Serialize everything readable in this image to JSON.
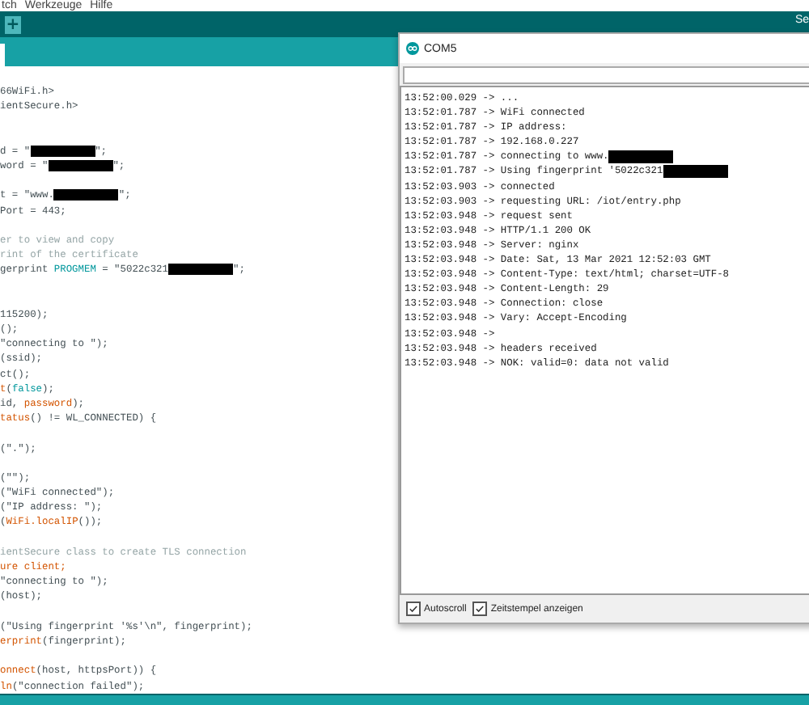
{
  "menu_bar": {
    "items": [
      "tch",
      "Werkzeuge",
      "Hilfe"
    ]
  },
  "toolbar": {
    "add_button": "+",
    "right_label": "Se"
  },
  "editor": {
    "lines": [
      [
        {
          "kind": "code",
          "text": "66WiFi.h>"
        }
      ],
      [
        {
          "kind": "code",
          "text": "ientSecure.h>"
        }
      ],
      [
        {
          "kind": "blank"
        }
      ],
      [
        {
          "kind": "blank"
        }
      ],
      [
        {
          "kind": "code",
          "text": "d = \""
        },
        {
          "kind": "redaction"
        },
        {
          "kind": "code",
          "text": "\";"
        }
      ],
      [
        {
          "kind": "code",
          "text": "word = \""
        },
        {
          "kind": "redaction"
        },
        {
          "kind": "code",
          "text": "\";"
        }
      ],
      [
        {
          "kind": "blank"
        }
      ],
      [
        {
          "kind": "code",
          "text": "t = \"www."
        },
        {
          "kind": "redaction"
        },
        {
          "kind": "code",
          "text": "\";"
        }
      ],
      [
        {
          "kind": "code",
          "text": "Port = 443;"
        }
      ],
      [
        {
          "kind": "blank"
        }
      ],
      [
        {
          "kind": "comment",
          "text": "er to view and copy"
        }
      ],
      [
        {
          "kind": "comment",
          "text": "rint of the certificate"
        }
      ],
      [
        {
          "kind": "code",
          "text": "gerprint "
        },
        {
          "kind": "keyword",
          "text": "PROGMEM"
        },
        {
          "kind": "code",
          "text": " = \"5022c321"
        },
        {
          "kind": "redaction"
        },
        {
          "kind": "code",
          "text": "\";"
        }
      ],
      [
        {
          "kind": "blank"
        }
      ],
      [
        {
          "kind": "blank"
        }
      ],
      [
        {
          "kind": "code",
          "text": "115200);"
        }
      ],
      [
        {
          "kind": "code",
          "text": "();"
        }
      ],
      [
        {
          "kind": "code",
          "text": "\"connecting to \");"
        }
      ],
      [
        {
          "kind": "code",
          "text": "(ssid);"
        }
      ],
      [
        {
          "kind": "code",
          "text": "ct();"
        }
      ],
      [
        {
          "kind": "function",
          "text": "t"
        },
        {
          "kind": "code",
          "text": "("
        },
        {
          "kind": "keyword",
          "text": "false"
        },
        {
          "kind": "code",
          "text": ");"
        }
      ],
      [
        {
          "kind": "code",
          "text": "id, "
        },
        {
          "kind": "function",
          "text": "password"
        },
        {
          "kind": "code",
          "text": ");"
        }
      ],
      [
        {
          "kind": "function",
          "text": "tatus"
        },
        {
          "kind": "code",
          "text": "() != WL_CONNECTED) {"
        }
      ],
      [
        {
          "kind": "blank"
        }
      ],
      [
        {
          "kind": "code",
          "text": "(\".\");"
        }
      ],
      [
        {
          "kind": "blank"
        }
      ],
      [
        {
          "kind": "code",
          "text": "(\"\");"
        }
      ],
      [
        {
          "kind": "code",
          "text": "(\"WiFi connected\");"
        }
      ],
      [
        {
          "kind": "code",
          "text": "(\"IP address: \");"
        }
      ],
      [
        {
          "kind": "code",
          "text": "("
        },
        {
          "kind": "function",
          "text": "WiFi.localIP"
        },
        {
          "kind": "code",
          "text": "());"
        }
      ],
      [
        {
          "kind": "blank"
        }
      ],
      [
        {
          "kind": "comment",
          "text": "ientSecure class to create TLS connection"
        }
      ],
      [
        {
          "kind": "function",
          "text": "ure client;"
        }
      ],
      [
        {
          "kind": "code",
          "text": "\"connecting to \");"
        }
      ],
      [
        {
          "kind": "code",
          "text": "(host);"
        }
      ],
      [
        {
          "kind": "blank"
        }
      ],
      [
        {
          "kind": "code",
          "text": "(\"Using fingerprint '%s'\\n\", fingerprint);"
        }
      ],
      [
        {
          "kind": "function",
          "text": "erprint"
        },
        {
          "kind": "code",
          "text": "(fingerprint);"
        }
      ],
      [
        {
          "kind": "blank"
        }
      ],
      [
        {
          "kind": "function",
          "text": "onnect"
        },
        {
          "kind": "code",
          "text": "(host, httpsPort)) {"
        }
      ],
      [
        {
          "kind": "function",
          "text": "ln"
        },
        {
          "kind": "code",
          "text": "(\"connection failed\");"
        }
      ]
    ]
  },
  "serial_monitor": {
    "title": "COM5",
    "lines": [
      [
        {
          "kind": "text",
          "text": "13:52:00.029 -> ..."
        }
      ],
      [
        {
          "kind": "text",
          "text": "13:52:01.787 -> WiFi connected"
        }
      ],
      [
        {
          "kind": "text",
          "text": "13:52:01.787 -> IP address:"
        }
      ],
      [
        {
          "kind": "text",
          "text": "13:52:01.787 -> 192.168.0.227"
        }
      ],
      [
        {
          "kind": "text",
          "text": "13:52:01.787 -> connecting to www."
        },
        {
          "kind": "redaction"
        }
      ],
      [
        {
          "kind": "text",
          "text": "13:52:01.787 -> Using fingerprint '5022c321"
        },
        {
          "kind": "redaction"
        }
      ],
      [
        {
          "kind": "text",
          "text": "13:52:03.903 -> connected"
        }
      ],
      [
        {
          "kind": "text",
          "text": "13:52:03.903 -> requesting URL: /iot/entry.php"
        }
      ],
      [
        {
          "kind": "text",
          "text": "13:52:03.948 -> request sent"
        }
      ],
      [
        {
          "kind": "text",
          "text": "13:52:03.948 -> HTTP/1.1 200 OK"
        }
      ],
      [
        {
          "kind": "text",
          "text": "13:52:03.948 -> Server: nginx"
        }
      ],
      [
        {
          "kind": "text",
          "text": "13:52:03.948 -> Date: Sat, 13 Mar 2021 12:52:03 GMT"
        }
      ],
      [
        {
          "kind": "text",
          "text": "13:52:03.948 -> Content-Type: text/html; charset=UTF-8"
        }
      ],
      [
        {
          "kind": "text",
          "text": "13:52:03.948 -> Content-Length: 29"
        }
      ],
      [
        {
          "kind": "text",
          "text": "13:52:03.948 -> Connection: close"
        }
      ],
      [
        {
          "kind": "text",
          "text": "13:52:03.948 -> Vary: Accept-Encoding"
        }
      ],
      [
        {
          "kind": "text",
          "text": "13:52:03.948 ->"
        }
      ],
      [
        {
          "kind": "text",
          "text": "13:52:03.948 -> headers received"
        }
      ],
      [
        {
          "kind": "text",
          "text": "13:52:03.948 -> NOK: valid=0: data not valid"
        }
      ]
    ],
    "options": [
      {
        "label": "Autoscroll",
        "checked": true
      },
      {
        "label": "Zeitstempel anzeigen",
        "checked": true
      }
    ]
  }
}
